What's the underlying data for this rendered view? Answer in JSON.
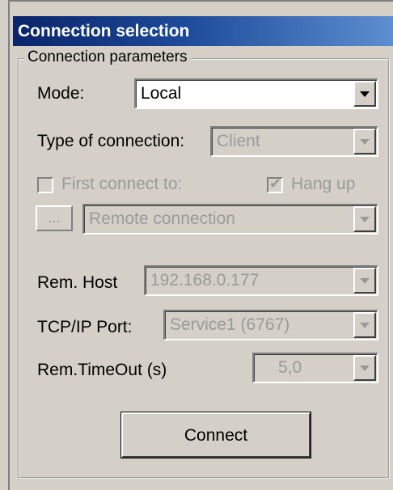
{
  "window": {
    "title": "Connection selection"
  },
  "group": {
    "title": "Connection parameters"
  },
  "mode": {
    "label": "Mode:",
    "value": "Local"
  },
  "connection_type": {
    "label": "Type of connection:",
    "value": "Client"
  },
  "first_connect": {
    "label": "First connect to:",
    "checked": false
  },
  "hang_up": {
    "label": "Hang up",
    "checked": true
  },
  "browse_button": {
    "label": "..."
  },
  "remote_connection": {
    "value": "Remote connection"
  },
  "rem_host": {
    "label": "Rem. Host",
    "value": "192.168.0.177"
  },
  "tcp_port": {
    "label": "TCP/IP Port:",
    "value": "Service1 (6767)"
  },
  "rem_timeout": {
    "label": "Rem.TimeOut (s)",
    "value": "5,0"
  },
  "connect_button": {
    "label": "Connect"
  },
  "colors": {
    "title_bar_start": "#0a246a",
    "title_bar_end": "#5d8ed0",
    "dialog_bg": "#d4d0c8",
    "disabled_text": "#9a9a9a"
  },
  "icons": {
    "dropdown": "chevron-down-icon",
    "check": "check-icon"
  }
}
